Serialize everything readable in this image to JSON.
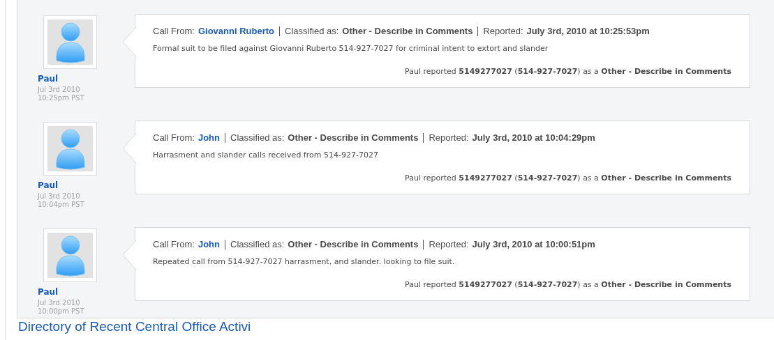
{
  "reports": [
    {
      "author": "Paul",
      "date": "Jul 3rd 2010",
      "time": "10:25pm PST",
      "call_from_label": "Call From:",
      "caller": "Giovanni Ruberto",
      "classified_label": "Classified as:",
      "classification": "Other - Describe in Comments",
      "reported_label": "Reported:",
      "reported": "July 3rd, 2010 at 10:25:53pm",
      "comment": "Formal suit to be filed against Giovanni Ruberto 514-927-7027 for criminal intent to extort and slander",
      "summary": "Paul reported **5149277027** (**514-927-7027**) as a **Other - Describe in Comments**"
    },
    {
      "author": "Paul",
      "date": "Jul 3rd 2010",
      "time": "10:04pm PST",
      "call_from_label": "Call From:",
      "caller": "John",
      "classified_label": "Classified as:",
      "classification": "Other - Describe in Comments",
      "reported_label": "Reported:",
      "reported": "July 3rd, 2010 at 10:04:29pm",
      "comment": "Harrasment and slander calls received from 514-927-7027",
      "summary": "Paul reported **5149277027** (**514-927-7027**) as a **Other - Describe in Comments**"
    },
    {
      "author": "Paul",
      "date": "Jul 3rd 2010",
      "time": "10:00pm PST",
      "call_from_label": "Call From:",
      "caller": "John",
      "classified_label": "Classified as:",
      "classification": "Other - Describe in Comments",
      "reported_label": "Reported:",
      "reported": "July 3rd, 2010 at 10:00:51pm",
      "comment": "Repeated call from 514-927-7027 harrasment, and slander. looking to file suit.",
      "summary": "Paul reported **5149277027** (**514-927-7027**) as a **Other - Describe in Comments**"
    }
  ],
  "section_heading": "Directory of Recent Central Office Activi"
}
